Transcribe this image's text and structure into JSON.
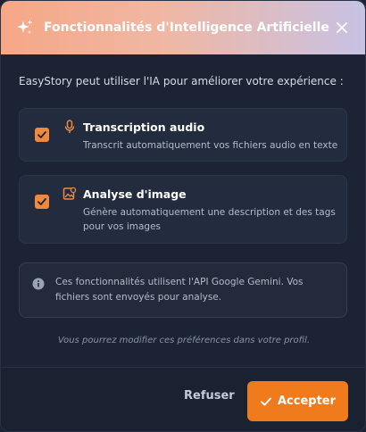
{
  "dialog": {
    "title": "Fonctionnalités d'Intelligence Artificielle",
    "title_icon": "sparkles-icon",
    "close_icon": "close-icon",
    "intro": "EasyStory peut utiliser l'IA pour améliorer votre expérience :"
  },
  "options": [
    {
      "icon": "microphone-icon",
      "title": "Transcription audio",
      "description": "Transcrit automatiquement vos fichiers audio en texte",
      "checked": true
    },
    {
      "icon": "image-scan-icon",
      "title": "Analyse d'image",
      "description": "Génère automatiquement une description et des tags pour vos images",
      "checked": true
    }
  ],
  "info": {
    "icon": "info-icon",
    "text": "Ces fonctionnalités utilisent l'API Google Gemini. Vos fichiers sont envoyés pour analyse."
  },
  "note": "Vous pourrez modifier ces préférences dans votre profil.",
  "buttons": {
    "refuse": "Refuser",
    "accept": "Accepter"
  },
  "colors": {
    "accent": "#f07b1c",
    "checkbox": "#f0893c",
    "background": "#1c2335",
    "card": "#232b3e"
  }
}
